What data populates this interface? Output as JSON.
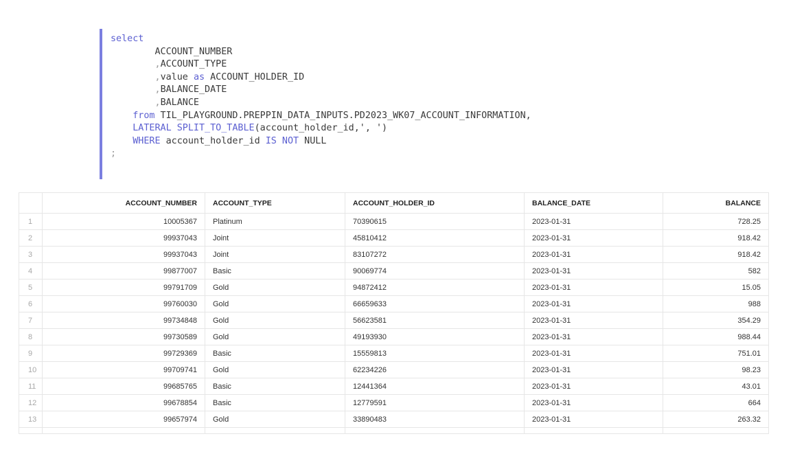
{
  "sql": {
    "lines": [
      [
        {
          "t": "select",
          "c": "kw"
        }
      ],
      [
        {
          "t": "        ACCOUNT_NUMBER",
          "c": "plain"
        }
      ],
      [
        {
          "t": "        ",
          "c": "plain"
        },
        {
          "t": ",",
          "c": "punct"
        },
        {
          "t": "ACCOUNT_TYPE",
          "c": "plain"
        }
      ],
      [
        {
          "t": "        ",
          "c": "plain"
        },
        {
          "t": ",",
          "c": "punct"
        },
        {
          "t": "value ",
          "c": "plain"
        },
        {
          "t": "as",
          "c": "kw"
        },
        {
          "t": " ACCOUNT_HOLDER_ID",
          "c": "plain"
        }
      ],
      [
        {
          "t": "        ",
          "c": "plain"
        },
        {
          "t": ",",
          "c": "punct"
        },
        {
          "t": "BALANCE_DATE",
          "c": "plain"
        }
      ],
      [
        {
          "t": "        ",
          "c": "plain"
        },
        {
          "t": ",",
          "c": "punct"
        },
        {
          "t": "BALANCE",
          "c": "plain"
        }
      ],
      [
        {
          "t": "    ",
          "c": "plain"
        },
        {
          "t": "from",
          "c": "kw"
        },
        {
          "t": " TIL_PLAYGROUND.PREPPIN_DATA_INPUTS.PD2023_WK07_ACCOUNT_INFORMATION,",
          "c": "plain"
        }
      ],
      [
        {
          "t": "    ",
          "c": "plain"
        },
        {
          "t": "LATERAL SPLIT_TO_TABLE",
          "c": "kw"
        },
        {
          "t": "(account_holder_id,', ')",
          "c": "plain"
        }
      ],
      [
        {
          "t": "    ",
          "c": "plain"
        },
        {
          "t": "WHERE",
          "c": "kw"
        },
        {
          "t": " account_holder_id ",
          "c": "plain"
        },
        {
          "t": "IS NOT",
          "c": "kw"
        },
        {
          "t": " NULL",
          "c": "plain"
        }
      ],
      [
        {
          "t": ";",
          "c": "punct"
        }
      ]
    ]
  },
  "results": {
    "columns": [
      {
        "label": "",
        "align": "left",
        "width": 34
      },
      {
        "label": "ACCOUNT_NUMBER",
        "align": "right",
        "width": 237
      },
      {
        "label": "ACCOUNT_TYPE",
        "align": "left",
        "width": 204
      },
      {
        "label": "ACCOUNT_HOLDER_ID",
        "align": "left",
        "width": 261
      },
      {
        "label": "BALANCE_DATE",
        "align": "left",
        "width": 202
      },
      {
        "label": "BALANCE",
        "align": "right",
        "width": 154
      }
    ],
    "rows": [
      [
        "1",
        "10005367",
        "Platinum",
        "70390615",
        "2023-01-31",
        "728.25"
      ],
      [
        "2",
        "99937043",
        "Joint",
        "45810412",
        "2023-01-31",
        "918.42"
      ],
      [
        "3",
        "99937043",
        "Joint",
        "83107272",
        "2023-01-31",
        "918.42"
      ],
      [
        "4",
        "99877007",
        "Basic",
        "90069774",
        "2023-01-31",
        "582"
      ],
      [
        "5",
        "99791709",
        "Gold",
        "94872412",
        "2023-01-31",
        "15.05"
      ],
      [
        "6",
        "99760030",
        "Gold",
        "66659633",
        "2023-01-31",
        "988"
      ],
      [
        "7",
        "99734848",
        "Gold",
        "56623581",
        "2023-01-31",
        "354.29"
      ],
      [
        "8",
        "99730589",
        "Gold",
        "49193930",
        "2023-01-31",
        "988.44"
      ],
      [
        "9",
        "99729369",
        "Basic",
        "15559813",
        "2023-01-31",
        "751.01"
      ],
      [
        "10",
        "99709741",
        "Gold",
        "62234226",
        "2023-01-31",
        "98.23"
      ],
      [
        "11",
        "99685765",
        "Basic",
        "12441364",
        "2023-01-31",
        "43.01"
      ],
      [
        "12",
        "99678854",
        "Basic",
        "12779591",
        "2023-01-31",
        "664"
      ],
      [
        "13",
        "99657974",
        "Gold",
        "33890483",
        "2023-01-31",
        "263.32"
      ]
    ]
  }
}
